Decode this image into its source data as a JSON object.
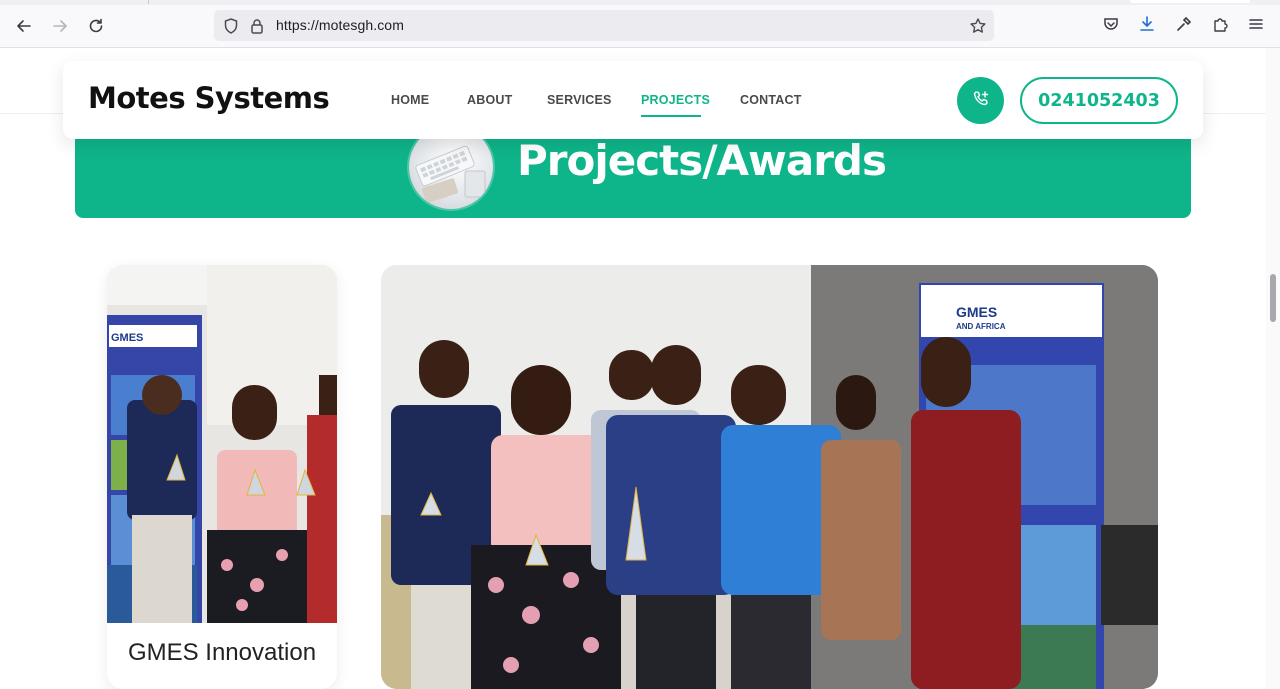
{
  "browser": {
    "url": "https://motesgh.com",
    "icons": [
      "back-arrow-icon",
      "forward-arrow-icon",
      "reload-icon",
      "shield-icon",
      "lock-icon",
      "star-icon",
      "pocket-icon",
      "download-icon",
      "eyedropper-icon",
      "extensions-icon",
      "menu-icon"
    ]
  },
  "site": {
    "brand": "Motes Systems",
    "nav": [
      "HOME",
      "ABOUT",
      "SERVICES",
      "PROJECTS",
      "CONTACT"
    ],
    "active_nav": "PROJECTS",
    "phone": "0241052403",
    "accent_color": "#0fb58a"
  },
  "hero": {
    "title": "Projects/Awards"
  },
  "cards": {
    "small_caption": "GMES Innovation"
  }
}
